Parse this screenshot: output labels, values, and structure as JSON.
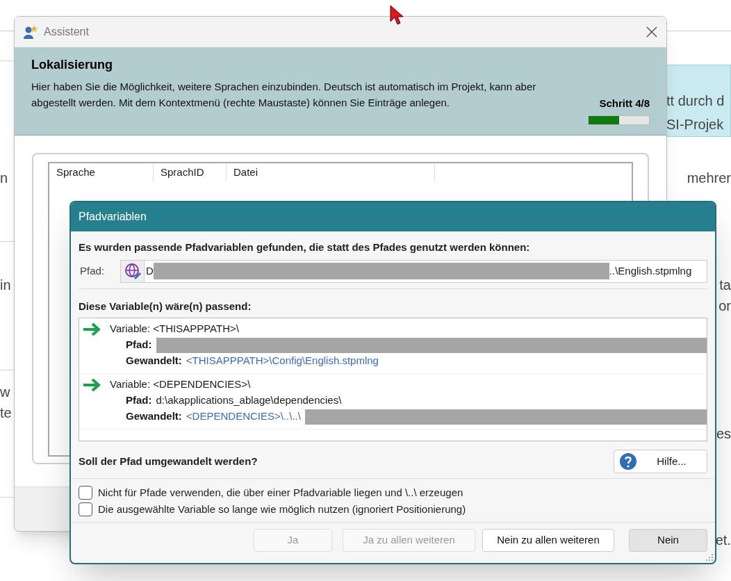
{
  "background": {
    "left_fragments": [
      "n",
      "in",
      "w",
      "te"
    ],
    "right_fragments": [
      "mehrer",
      "ta",
      "or",
      "es",
      "et."
    ],
    "card_lines": [
      "tt durch d",
      "SI-Projek"
    ]
  },
  "assistant": {
    "title": "Assistent",
    "header": {
      "title": "Lokalisierung",
      "text": "Hier haben Sie die Möglichkeit, weitere Sprachen einzubinden. Deutsch ist automatisch im Projekt, kann aber abgestellt werden. Mit dem Kontextmenü (rechte Maustaste) können Sie Einträge anlegen.",
      "step": "Schritt 4/8",
      "level": 0.5
    },
    "table": {
      "columns": [
        "Sprache",
        "SprachID",
        "Datei"
      ]
    }
  },
  "pfad_dialog": {
    "title": "Pfadvariablen",
    "intro": "Es wurden passende Pfadvariablen gefunden, die statt des Pfades genutzt werden können:",
    "path": {
      "label": "Pfad:",
      "value_start": "D",
      "value_end": "..\\English.stpmlng"
    },
    "list_label": "Diese Variable(n) wäre(n) passend:",
    "variables": [
      {
        "variable": "Variable: <THISAPPPATH>\\",
        "pfad_label": "Pfad:",
        "pfad_redacted": true,
        "gewandelt_label": "Gewandelt:",
        "gewandelt": "<THISAPPPATH>\\Config\\English.stpmlng",
        "gewandelt_redacted": false
      },
      {
        "variable": "Variable: <DEPENDENCIES>\\",
        "pfad_label": "Pfad:",
        "pfad": "d:\\akapplications_ablage\\dependencies\\",
        "pfad_redacted": false,
        "gewandelt_label": "Gewandelt:",
        "gewandelt": "<DEPENDENCIES>\\..\\..\\",
        "gewandelt_redacted": true
      }
    ],
    "question": "Soll der Pfad umgewandelt werden?",
    "help_button": "Hilfe...",
    "options": [
      {
        "label": "Nicht für Pfade verwenden, die über einer Pfadvariable liegen und \\..\\ erzeugen",
        "checked": false
      },
      {
        "label": "Die ausgewählte Variable so lange wie möglich nutzen (ignoriert Positionierung)",
        "checked": false
      }
    ],
    "buttons": [
      {
        "label": "Ja",
        "disabled": true,
        "default": false
      },
      {
        "label": "Ja zu allen weiteren",
        "disabled": true,
        "default": false
      },
      {
        "label": "Nein zu allen weiteren",
        "disabled": false,
        "default": false
      },
      {
        "label": "Nein",
        "disabled": false,
        "default": true
      }
    ]
  }
}
